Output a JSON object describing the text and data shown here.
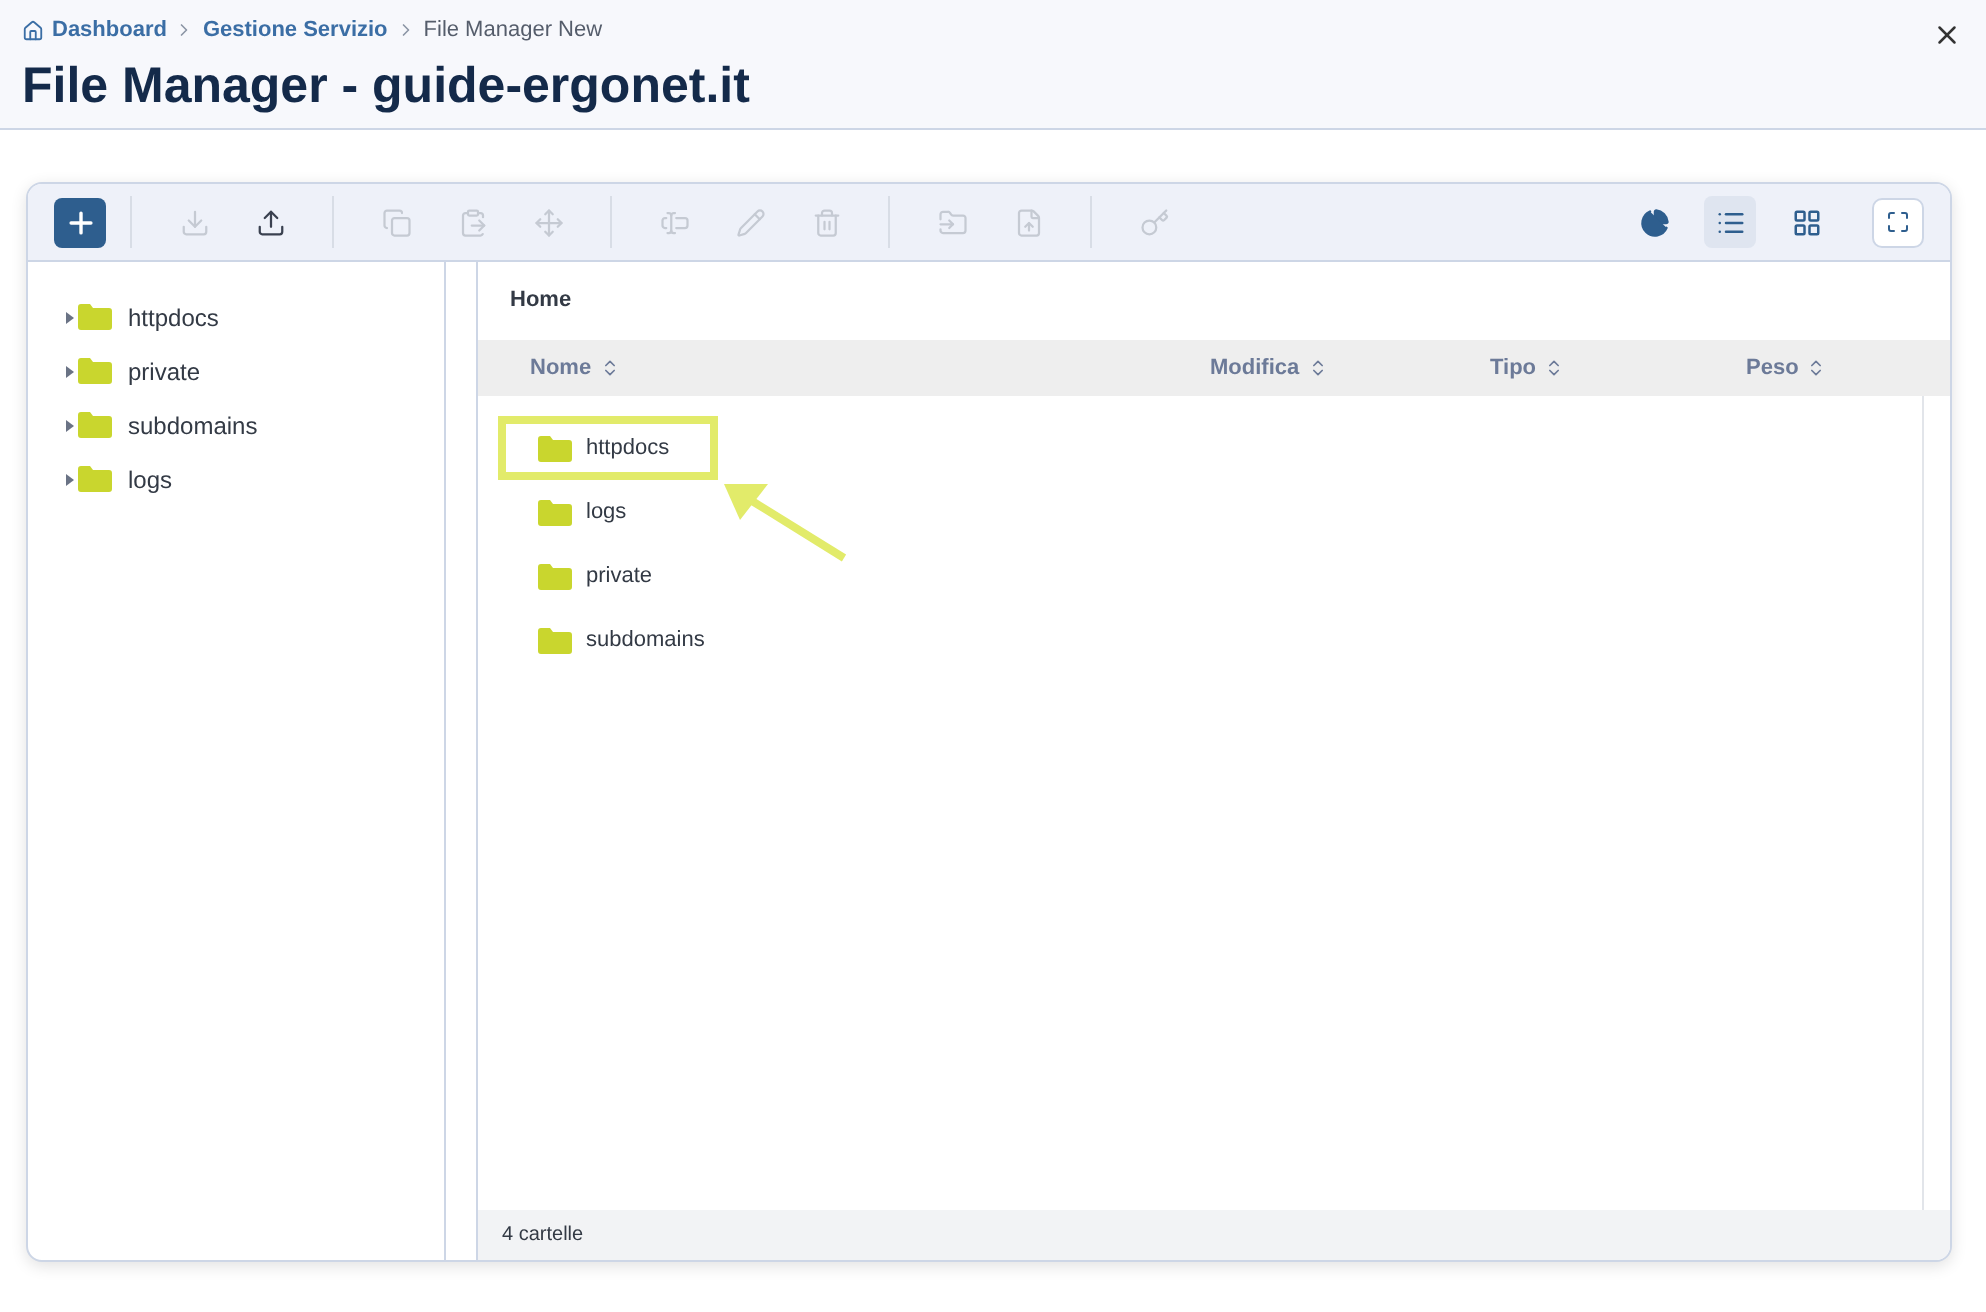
{
  "breadcrumb": [
    {
      "label": "Dashboard",
      "kind": "home",
      "link": true
    },
    {
      "label": "Gestione Servizio",
      "kind": "plain",
      "link": true
    },
    {
      "label": "File Manager New",
      "kind": "plain",
      "link": false
    }
  ],
  "title": "File Manager - guide-ergonet.it",
  "toolbar": [
    {
      "kind": "add",
      "disabled": false
    },
    {
      "kind": "download",
      "disabled": true
    },
    {
      "kind": "upload",
      "disabled": false
    },
    {
      "kind": "copy",
      "disabled": true
    },
    {
      "kind": "paste",
      "disabled": true
    },
    {
      "kind": "move",
      "disabled": true
    },
    {
      "kind": "rename",
      "disabled": true
    },
    {
      "kind": "edit",
      "disabled": true
    },
    {
      "kind": "delete",
      "disabled": true
    },
    {
      "kind": "archive",
      "disabled": true
    },
    {
      "kind": "extract",
      "disabled": true
    },
    {
      "kind": "permissions",
      "disabled": true
    }
  ],
  "views": [
    {
      "kind": "info",
      "selected": false
    },
    {
      "kind": "list",
      "selected": true
    },
    {
      "kind": "grid",
      "selected": false
    }
  ],
  "tree": [
    {
      "label": "httpdocs",
      "expanded": false
    },
    {
      "label": "private",
      "expanded": false
    },
    {
      "label": "subdomains",
      "expanded": false
    },
    {
      "label": "logs",
      "expanded": false
    }
  ],
  "path": "Home",
  "columns": [
    "Nome",
    "Modifica",
    "Tipo",
    "Peso"
  ],
  "rows": [
    {
      "name": "httpdocs",
      "highlighted": true
    },
    {
      "name": "logs",
      "highlighted": false
    },
    {
      "name": "private",
      "highlighted": false
    },
    {
      "name": "subdomains",
      "highlighted": false
    }
  ],
  "status": "4 cartelle"
}
